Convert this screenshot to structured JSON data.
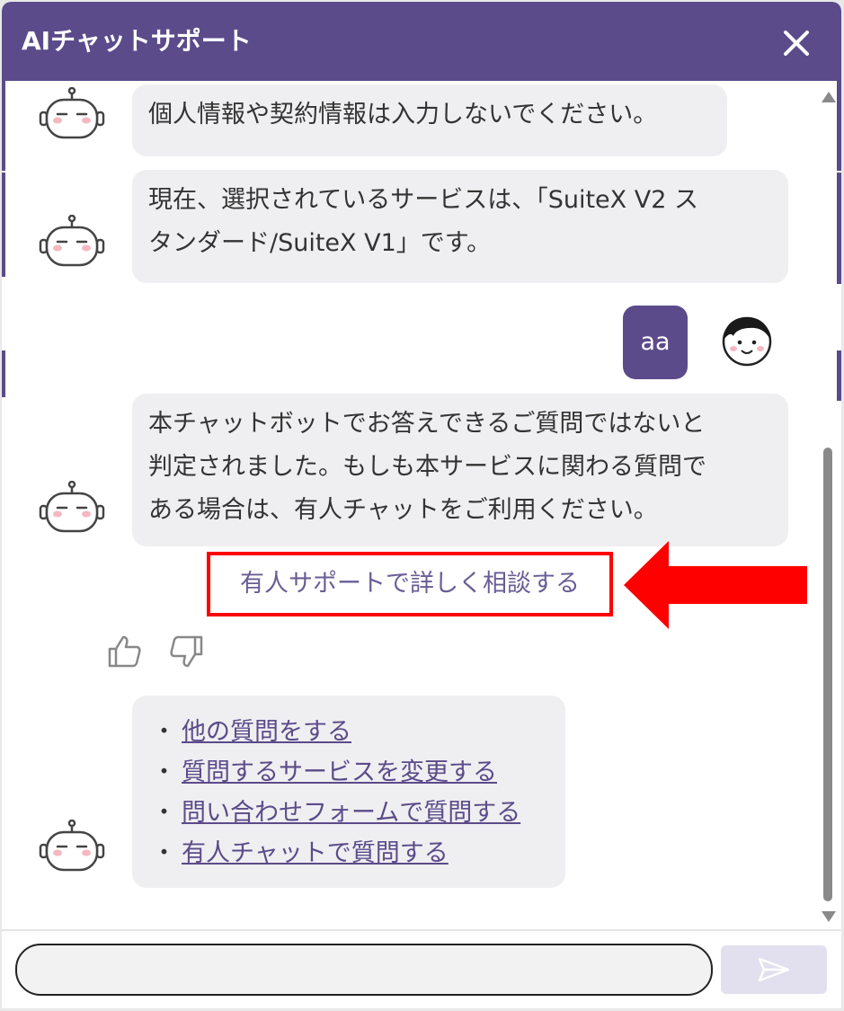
{
  "header": {
    "title": "AIチャットサポート",
    "close_icon": "close-icon"
  },
  "colors": {
    "brand": "#5b4b8a",
    "bubble_bg": "#efeff1",
    "highlight": "#ff0000",
    "link": "#5b4b8a"
  },
  "messages": {
    "bot1": {
      "lines": [
        "個人情報や契約情報は入力しないでください。"
      ]
    },
    "bot2": {
      "lines": [
        "現在、選択されているサービスは、「SuiteX V2 ス",
        "タンダード/SuiteX V1」です。"
      ]
    },
    "user1": {
      "text": "aa"
    },
    "bot3": {
      "lines": [
        "本チャットボットでお答えできるご質問ではないと",
        "判定されました。もしも本サービスに関わる質問で",
        "ある場合は、有人チャットをご利用ください。"
      ]
    }
  },
  "support_link": {
    "label": "有人サポートで詳しく相談する"
  },
  "feedback": {
    "like_icon": "thumbs-up-icon",
    "dislike_icon": "thumbs-down-icon"
  },
  "menu": {
    "bullet": "・",
    "items": [
      {
        "label": "他の質問をする"
      },
      {
        "label": "質問するサービスを変更する"
      },
      {
        "label": "問い合わせフォームで質問する"
      },
      {
        "label": "有人チャットで質問する"
      }
    ]
  },
  "input": {
    "value": "",
    "placeholder": ""
  },
  "send": {
    "icon": "send-icon"
  }
}
